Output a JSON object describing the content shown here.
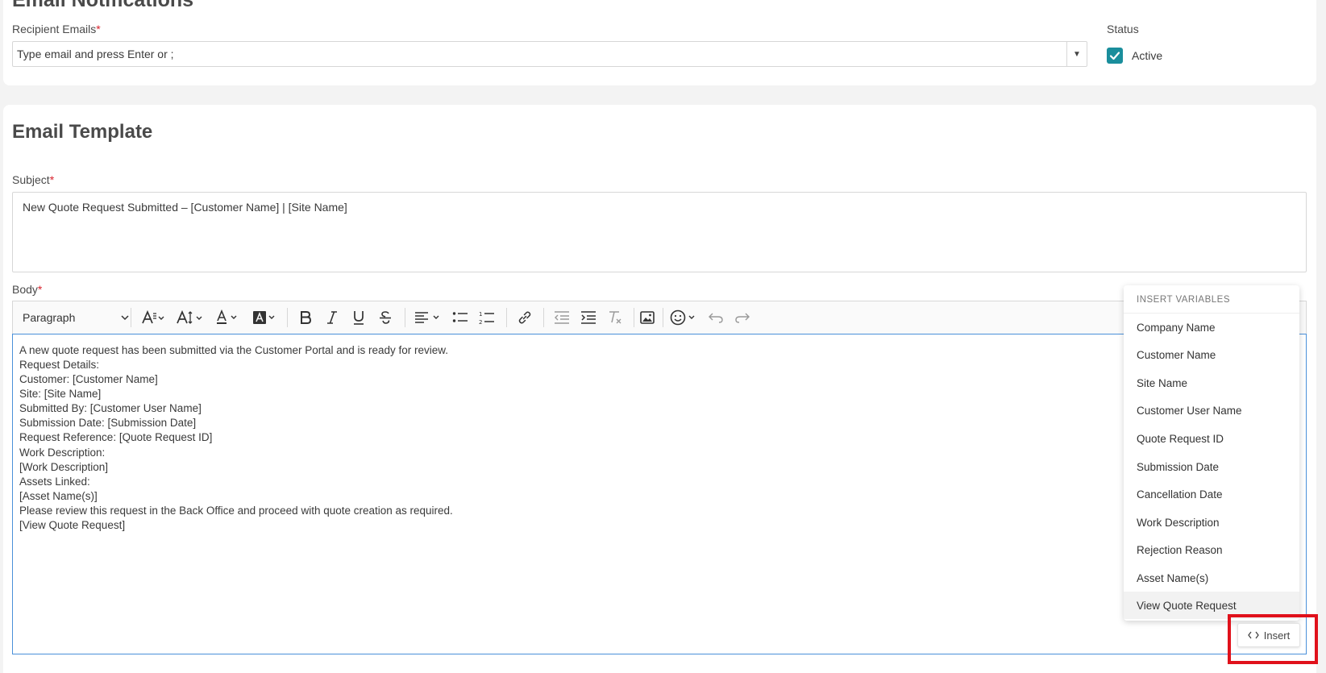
{
  "email_notifications": {
    "title": "Email Notifications",
    "recipient_label": "Recipient Emails",
    "required_mark": "*",
    "recipient_placeholder": "Type email and press Enter or ;",
    "status_label": "Status",
    "status_checkbox_label": "Active",
    "status_checked": true
  },
  "email_template": {
    "title": "Email Template",
    "subject_label": "Subject",
    "subject_value": "New Quote Request Submitted – [Customer Name] | [Site Name]",
    "body_label": "Body",
    "required_mark": "*"
  },
  "toolbar": {
    "paragraph_select": "Paragraph",
    "icons": [
      "font-family-icon",
      "font-size-icon",
      "font-color-icon",
      "background-color-icon",
      "bold-icon",
      "italic-icon",
      "underline-icon",
      "strikethrough-icon",
      "align-icon",
      "bulleted-list-icon",
      "numbered-list-icon",
      "link-icon",
      "outdent-icon",
      "indent-icon",
      "remove-format-icon",
      "image-icon",
      "emoji-icon",
      "undo-icon",
      "redo-icon"
    ]
  },
  "body_lines": [
    "A new quote request has been submitted via the Customer Portal and is ready for review.",
    "Request Details:",
    "Customer: [Customer Name]",
    "Site: [Site Name]",
    "Submitted By: [Customer User Name]",
    "Submission Date: [Submission Date]",
    "Request Reference: [Quote Request ID]",
    "Work Description:",
    "[Work Description]",
    "Assets Linked:",
    "[Asset Name(s)]",
    "Please review this request in the Back Office and proceed with quote creation as required.",
    "[View Quote Request]"
  ],
  "insert_variables": {
    "header": "INSERT VARIABLES",
    "items": [
      "Company Name",
      "Customer Name",
      "Site Name",
      "Customer User Name",
      "Quote Request ID",
      "Submission Date",
      "Cancellation Date",
      "Work Description",
      "Rejection Reason",
      "Asset Name(s)",
      "View Quote Request"
    ],
    "highlighted": "View Quote Request"
  },
  "insert_button": {
    "label": "Insert",
    "icon": "code-brackets-icon"
  },
  "colors": {
    "accent": "#1a8e9c",
    "required": "#d9232d",
    "editor_focus": "#4a90d9",
    "highlight_box": "#e0111b"
  }
}
